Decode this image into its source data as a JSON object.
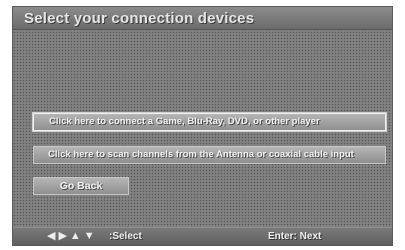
{
  "screen": {
    "title": "Select your connection devices"
  },
  "menu": {
    "game_player": "Click here to connect a Game, Blu-Ray, DVD, or other player",
    "scan_channels": "Click here to scan channels from the Antenna or coaxial cable input",
    "go_back": "Go Back"
  },
  "footer": {
    "arrows_glyphs": "◀▶▲▼",
    "select_label": ":Select",
    "enter_label": "Enter: Next"
  },
  "colors": {
    "background": "#7b7b7b",
    "button": "#a3a3a3",
    "text": "#f3f3f3"
  },
  "icons": [
    "left-arrow-icon",
    "right-arrow-icon",
    "up-arrow-icon",
    "down-arrow-icon"
  ]
}
